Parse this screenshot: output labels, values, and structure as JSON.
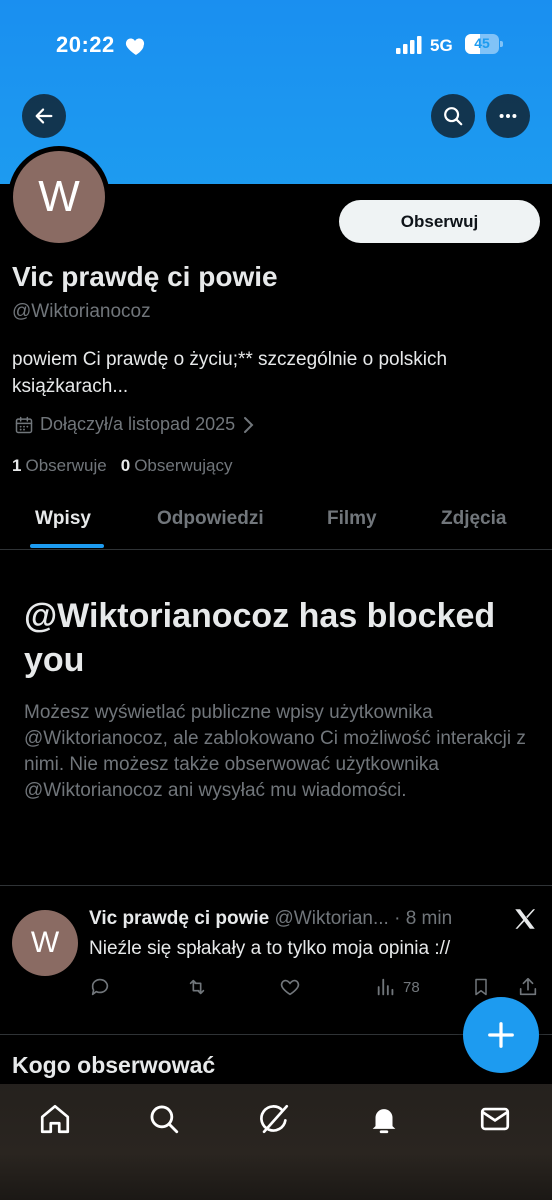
{
  "status_bar": {
    "time": "20:22",
    "network": "5G",
    "battery": "45",
    "battery_level": 0.45
  },
  "profile": {
    "avatar_letter": "W",
    "follow_label": "Obserwuj",
    "name": "Vic prawdę ci powie",
    "handle": "@Wiktorianocoz",
    "bio": "powiem Ci prawdę o życiu;** szczególnie o polskich książkarach...",
    "joined": "Dołączył/a listopad 2025",
    "following_count": "1",
    "following_label": "Obserwuje",
    "followers_count": "0",
    "followers_label": "Obserwujący"
  },
  "tabs": [
    {
      "label": "Wpisy",
      "active": true
    },
    {
      "label": "Odpowiedzi",
      "active": false
    },
    {
      "label": "Filmy",
      "active": false
    },
    {
      "label": "Zdjęcia",
      "active": false
    }
  ],
  "blocked": {
    "title": "@Wiktorianocoz has blocked you",
    "text": "Możesz wyświetlać publiczne wpisy użytkownika @Wiktorianocoz, ale zablokowano Ci możliwość interakcji z nimi. Nie możesz także obserwować użytkownika @Wiktorianocoz ani wysyłać mu wiadomości."
  },
  "tweet": {
    "avatar_letter": "W",
    "name": "Vic prawdę ci powie",
    "handle_time": "@Wiktorian... · 8 min",
    "text": "Nieźle się spłakały a to tylko moja opinia ://",
    "views": "78"
  },
  "who_to_follow": "Kogo obserwować",
  "colors": {
    "accent": "#1d9bf0",
    "background": "#000000",
    "muted": "#71767b",
    "avatar": "#8a6b63"
  },
  "icons": {
    "top": [
      "arrow-left-icon",
      "search-icon",
      "more-icon"
    ],
    "tweet_actions": [
      "reply-icon",
      "retweet-icon",
      "like-icon",
      "views-icon",
      "bookmark-icon",
      "share-icon"
    ],
    "bottom_nav": [
      "home-icon",
      "search-icon",
      "grok-icon",
      "notifications-icon",
      "messages-icon"
    ]
  }
}
